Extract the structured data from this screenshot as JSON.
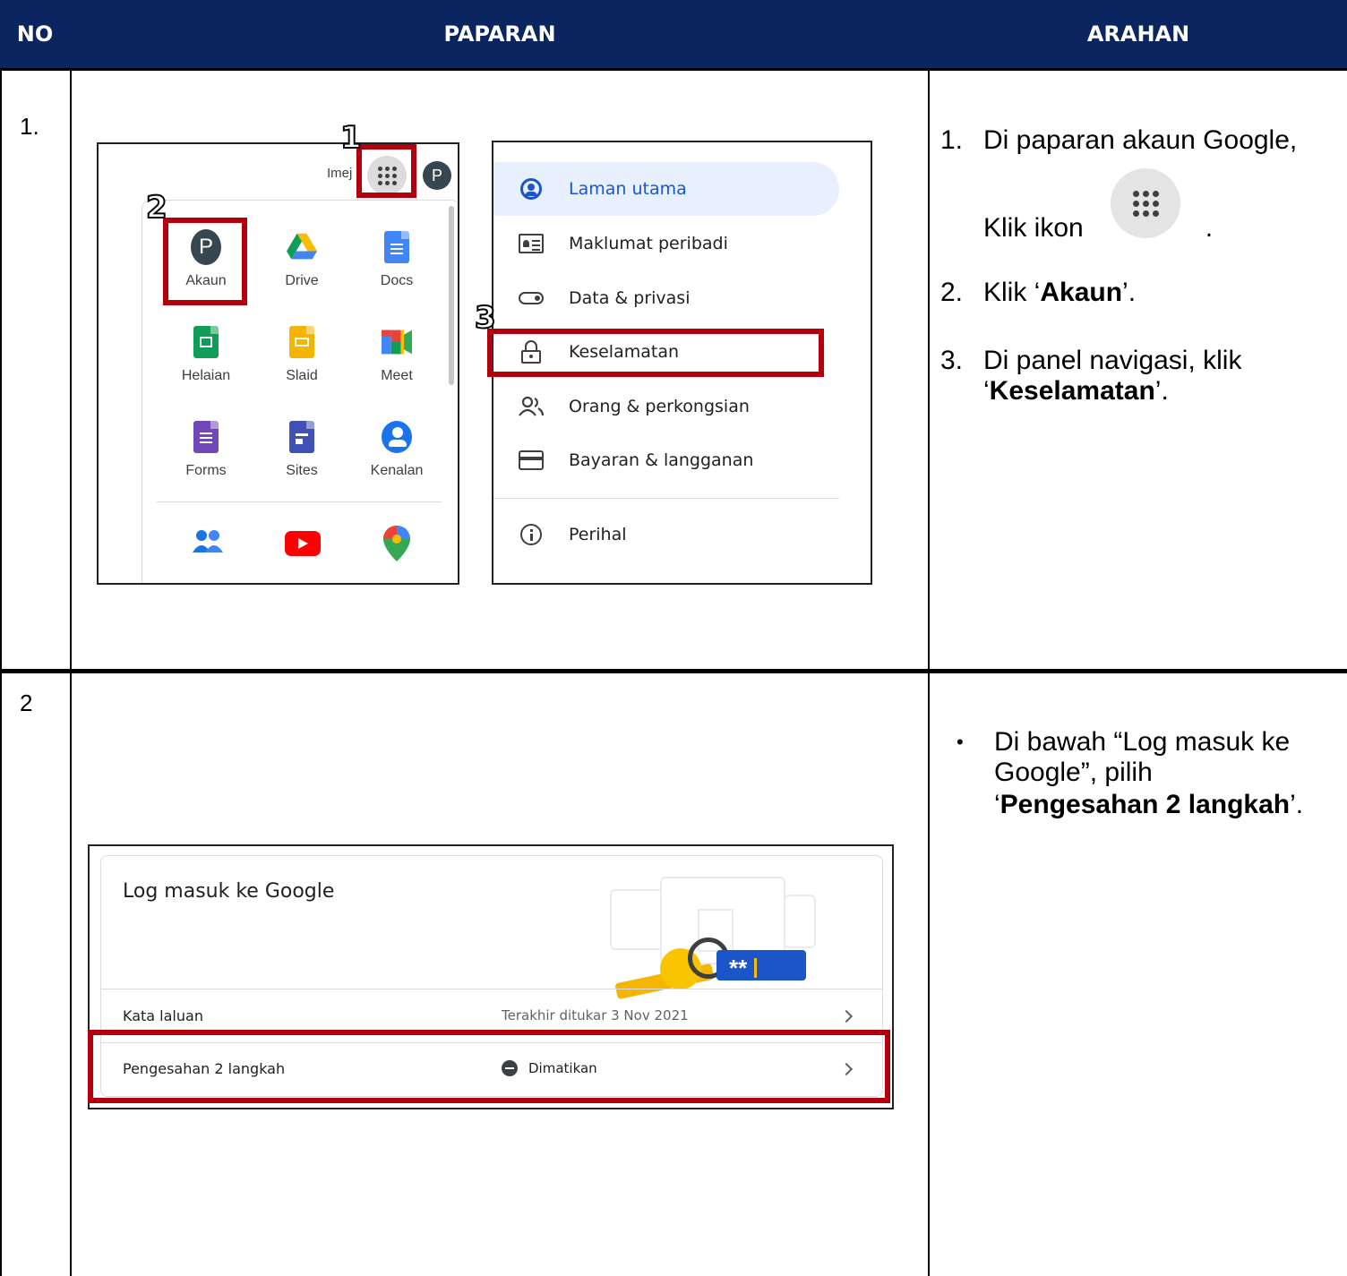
{
  "header": {
    "col_no": "NO",
    "col_paparan": "PAPARAN",
    "col_arahan": "ARAHAN"
  },
  "rows": [
    {
      "no": "1."
    },
    {
      "no": "2"
    }
  ],
  "step1": {
    "callouts": [
      "1",
      "2",
      "3"
    ],
    "topbar_text": "Imej",
    "avatar_letter": "P",
    "apps": [
      {
        "label": "Akaun",
        "icon": "account-avatar-icon"
      },
      {
        "label": "Drive",
        "icon": "drive-icon"
      },
      {
        "label": "Docs",
        "icon": "docs-icon"
      },
      {
        "label": "Helaian",
        "icon": "sheets-icon"
      },
      {
        "label": "Slaid",
        "icon": "slides-icon"
      },
      {
        "label": "Meet",
        "icon": "meet-icon"
      },
      {
        "label": "Forms",
        "icon": "forms-icon"
      },
      {
        "label": "Sites",
        "icon": "sites-icon"
      },
      {
        "label": "Kenalan",
        "icon": "contacts-icon"
      }
    ],
    "nav": [
      {
        "label": "Laman utama",
        "icon": "home-account-icon"
      },
      {
        "label": "Maklumat peribadi",
        "icon": "id-card-icon"
      },
      {
        "label": "Data & privasi",
        "icon": "toggle-icon"
      },
      {
        "label": "Keselamatan",
        "icon": "lock-icon"
      },
      {
        "label": "Orang & perkongsian",
        "icon": "people-icon"
      },
      {
        "label": "Bayaran & langganan",
        "icon": "credit-card-icon"
      },
      {
        "label": "Perihal",
        "icon": "info-icon"
      }
    ]
  },
  "instructions1": {
    "s1_num": "1.",
    "s1_text": "Di paparan akaun Google,",
    "s1b_text": "Klik ikon",
    "s1b_end": ".",
    "s2_num": "2.",
    "s2_pre": "Klik ‘",
    "s2_bold": "Akaun",
    "s2_post": "’.",
    "s3_num": "3.",
    "s3_text": "Di panel navigasi, klik",
    "s3_pre": "‘",
    "s3_bold": "Keselamatan",
    "s3_post": "’."
  },
  "step2": {
    "card_title": "Log masuk ke Google",
    "rows": [
      {
        "label": "Kata laluan",
        "value": "Terakhir ditukar 3 Nov 2021"
      },
      {
        "label": "Pengesahan 2 langkah",
        "value": "Dimatikan"
      }
    ],
    "illustration_text": "**"
  },
  "instructions2": {
    "bullet": "•",
    "line1": "Di bawah “Log masuk ke",
    "line2": "Google”, pilih",
    "line3_pre": "‘",
    "line3_bold": "Pengesahan 2 langkah",
    "line3_post": "’."
  }
}
